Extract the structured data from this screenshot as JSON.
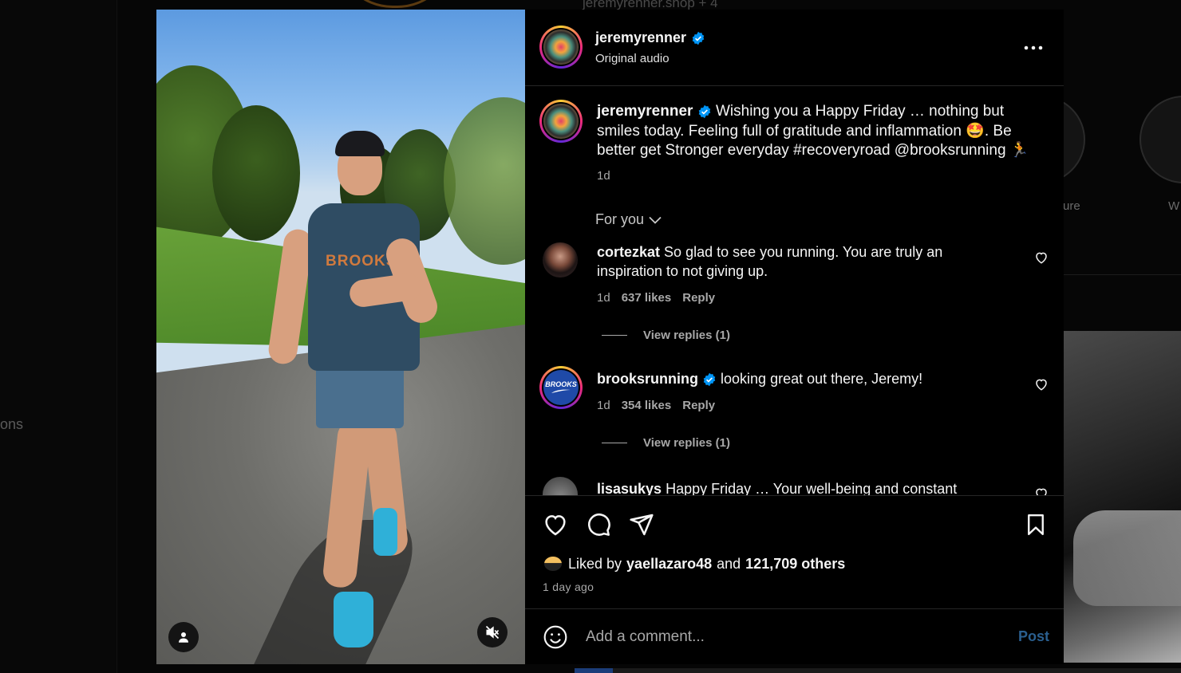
{
  "background": {
    "left_nav_fragment": "ons",
    "profile_link": "jeremyrenner.shop + 4",
    "highlight_labels": [
      "ure",
      "W"
    ]
  },
  "post": {
    "author": "jeremyrenner",
    "author_verified": true,
    "audio": "Original audio",
    "caption": "Wishing you a Happy Friday … nothing but smiles today. Feeling full of gratitude and inflammation 🤩. Be better get Stronger everyday #recoveryroad @brooksrunning 🏃",
    "caption_time": "1d",
    "shirt_text": "BROOKS",
    "sort_label": "For you"
  },
  "comments": [
    {
      "username": "cortezkat",
      "verified": false,
      "text": "So glad to see you running. You are truly an inspiration to not giving up.",
      "time": "1d",
      "likes": "637 likes",
      "reply_label": "Reply",
      "view_replies": "View replies (1)"
    },
    {
      "username": "brooksrunning",
      "verified": true,
      "text": "looking great out there, Jeremy!",
      "time": "1d",
      "likes": "354 likes",
      "reply_label": "Reply",
      "view_replies": "View replies (1)",
      "avatar_text": "BROOKS"
    },
    {
      "username": "lisasukys",
      "verified": false,
      "text": "Happy Friday … Your well-being and constant"
    }
  ],
  "actions": {
    "liked_by_prefix": "Liked by",
    "liked_by_user": "yaellazaro48",
    "liked_by_and": "and",
    "liked_by_others": "121,709 others",
    "posted_ago": "1 day ago"
  },
  "add_comment": {
    "placeholder": "Add a comment...",
    "post_label": "Post"
  },
  "colors": {
    "verified_blue": "#0095f6",
    "post_button_disabled": "#2a5f8f",
    "muted_text": "#a8a8a8"
  },
  "icons": [
    "verified-badge-icon",
    "more-options-icon",
    "chevron-down-icon",
    "heart-icon",
    "comment-icon",
    "share-icon",
    "bookmark-icon",
    "emoji-icon",
    "user-icon",
    "muted-speaker-icon"
  ]
}
